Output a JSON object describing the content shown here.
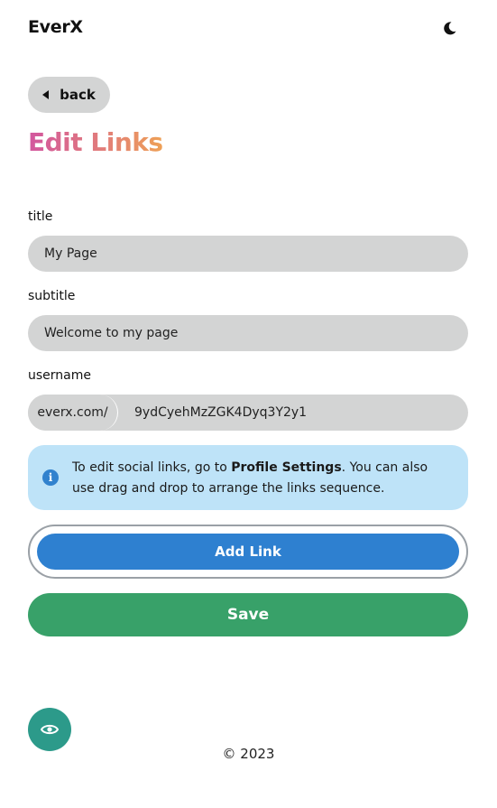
{
  "header": {
    "brand": "EverX",
    "theme_toggle_icon": "moon-icon"
  },
  "nav": {
    "back_label": "back",
    "back_icon": "triangle-left-icon"
  },
  "page": {
    "title": "Edit Links"
  },
  "form": {
    "title_label": "title",
    "title_value": "My Page",
    "subtitle_label": "subtitle",
    "subtitle_value": "Welcome to my page",
    "username_label": "username",
    "username_prefix": "everx.com/",
    "username_value": "9ydCyehMzZGK4Dyq3Y2y1"
  },
  "info": {
    "icon": "info-icon",
    "text_before": "To edit social links, go to ",
    "text_bold": "Profile Settings",
    "text_after": ". You can also use drag and drop to arrange the links sequence."
  },
  "actions": {
    "add_link_label": "Add Link",
    "save_label": "Save",
    "preview_icon": "eye-icon"
  },
  "footer": {
    "copyright": "© 2023"
  },
  "colors": {
    "input_bg": "#d3d4d4",
    "info_bg": "#bee3f8",
    "info_icon": "#3182ce",
    "add_link": "#2e80d0",
    "save": "#38a169",
    "preview": "#2c9a8a",
    "title_gradient_start": "#d2569f",
    "title_gradient_end": "#eea055"
  }
}
